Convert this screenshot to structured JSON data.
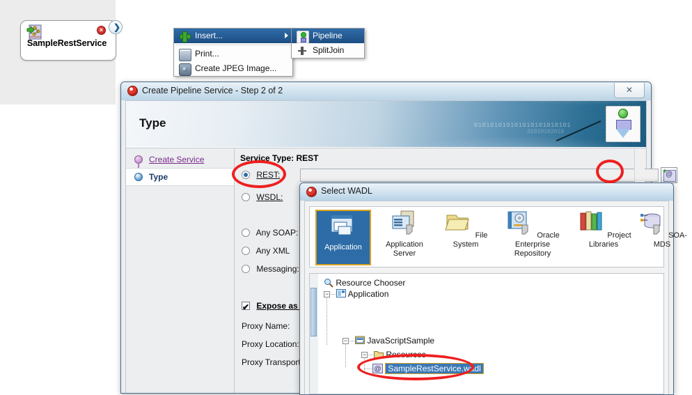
{
  "canvas": {
    "node": {
      "label": "SampleRestService",
      "error_badge": "×",
      "arrow_glyph": "❯",
      "icon": "rest-service-icon"
    }
  },
  "context_menu": {
    "items": [
      {
        "label": "Insert...",
        "icon": "plus-icon",
        "selected": true,
        "has_submenu": true
      },
      {
        "label": "Print...",
        "icon": "printer-icon",
        "selected": false,
        "has_submenu": false
      },
      {
        "label": "Create JPEG Image...",
        "icon": "camera-icon",
        "selected": false,
        "has_submenu": false
      }
    ],
    "submenu": [
      {
        "label": "Pipeline",
        "icon": "pipeline-icon",
        "selected": true
      },
      {
        "label": "SplitJoin",
        "icon": "splitjoin-icon",
        "selected": false
      }
    ]
  },
  "wizard": {
    "title": "Create Pipeline Service - Step 2 of 2",
    "close_glyph": "✕",
    "banner_title": "Type",
    "banner_bits": "010101010101010101010101",
    "banner_bits2": "01010102010",
    "nav": [
      {
        "label": "Create Service",
        "state": "done"
      },
      {
        "label": "Type",
        "state": "current"
      }
    ],
    "service_type": "Service Type: REST",
    "options": [
      {
        "label": "REST:",
        "accel": "R",
        "selected": true
      },
      {
        "label": "WSDL:",
        "accel": "W",
        "selected": false
      },
      {
        "label": "Any SOAP:",
        "accel": "S",
        "selected": false
      },
      {
        "label": "Any XML",
        "accel": "X",
        "selected": false
      },
      {
        "label": "Messaging:",
        "accel": "g",
        "selected": false
      }
    ],
    "rest_value": "",
    "browse_icon": "select-wadl-browse-icon",
    "expose_label": "Expose as a",
    "expose_checked": true,
    "check_glyph": "✔",
    "fields": [
      {
        "label": "Proxy Name:"
      },
      {
        "label": "Proxy Location:"
      },
      {
        "label": "Proxy Transport:"
      }
    ]
  },
  "wadl_dialog": {
    "title": "Select WADL",
    "sources": [
      {
        "label": "Application",
        "icon": "application-icon",
        "selected": true
      },
      {
        "label": "Application\nServer",
        "icon": "application-server-icon",
        "selected": false
      },
      {
        "label": "File System",
        "icon": "file-system-icon",
        "selected": false
      },
      {
        "label": "Oracle Enterprise\nRepository",
        "icon": "oracle-enterprise-repository-icon",
        "selected": false
      },
      {
        "label": "Project\nLibraries",
        "icon": "project-libraries-icon",
        "selected": false
      },
      {
        "label": "SOA-MDS",
        "icon": "soa-mds-icon",
        "selected": false
      }
    ],
    "tree": {
      "header": "Resource Chooser",
      "root": "Application",
      "project": "JavaScriptSample",
      "folder": "Resources",
      "selected_file": "SampleRestService.wadl"
    }
  },
  "annotations": {
    "colors": {
      "highlight": "#ef1f1f",
      "selection": "#3a78b5",
      "selection_border": "#d8a21f",
      "menu_selected": "#2f6ca8"
    },
    "ovals": [
      "rest-radio-oval",
      "browse-button-oval",
      "wadl-file-oval"
    ]
  }
}
